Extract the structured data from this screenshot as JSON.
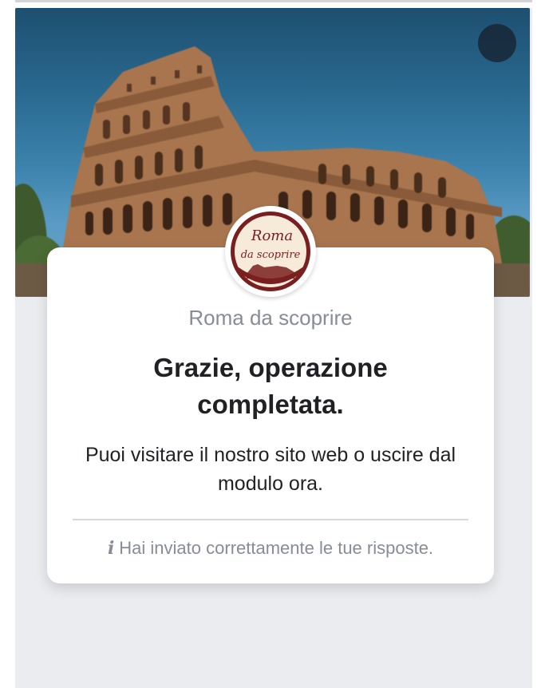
{
  "hero": {
    "image": "colosseum-rome-photo",
    "close_icon": "close-icon"
  },
  "logo": {
    "line1": "Roma",
    "line2": "da scoprire",
    "colors": {
      "ring": "#7a1f1f",
      "fill": "#f6ead8",
      "text": "#7a1f1f"
    }
  },
  "card": {
    "org_name": "Roma da scoprire",
    "title": "Grazie, operazione completata.",
    "message": "Puoi visitare il nostro sito web o uscire dal modulo ora.",
    "info_icon": "i",
    "footnote": "Hai inviato correttamente le tue risposte."
  },
  "colors": {
    "panel_bg": "#eaecef",
    "card_bg": "#ffffff",
    "title_text": "#1f2124",
    "muted_text": "#868d96"
  }
}
